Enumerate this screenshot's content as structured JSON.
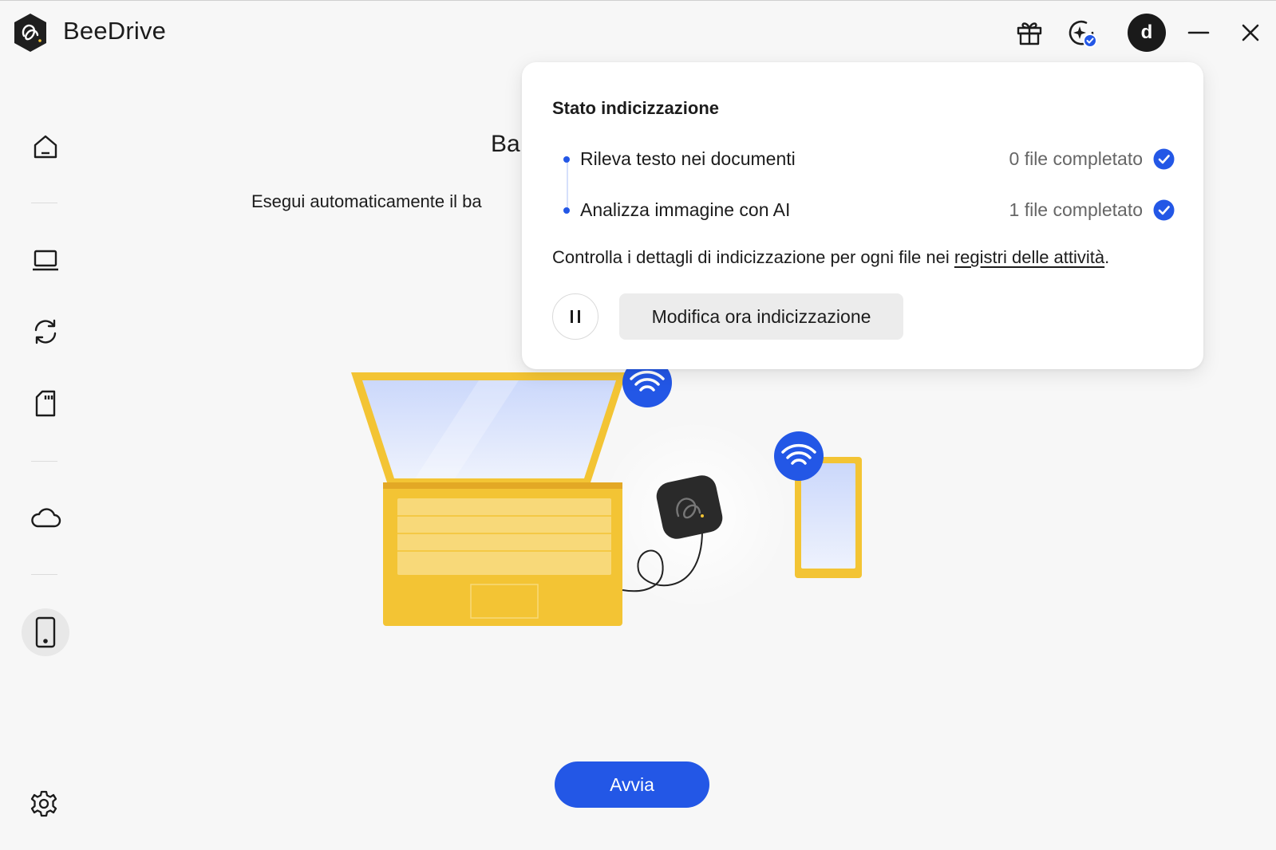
{
  "app": {
    "title": "BeeDrive"
  },
  "topbar": {
    "avatar_letter": "d"
  },
  "sidebar": {
    "items": [
      {
        "icon": "home-icon"
      },
      {
        "icon": "laptop-icon"
      },
      {
        "icon": "sync-icon"
      },
      {
        "icon": "sd-card-icon"
      },
      {
        "icon": "cloud-icon"
      },
      {
        "icon": "mobile-phone-icon"
      },
      {
        "icon": "gear-icon"
      }
    ]
  },
  "main": {
    "title_visible": "Ba",
    "description_visible": "Esegui automaticamente il ba",
    "start_button": "Avvia"
  },
  "popup": {
    "title": "Stato indicizzazione",
    "tasks": [
      {
        "name": "Rileva testo nei documenti",
        "status": "0 file completato"
      },
      {
        "name": "Analizza immagine con AI",
        "status": "1 file completato"
      }
    ],
    "note_prefix": "Controlla i dettagli di indicizzazione per ogni file nei ",
    "note_link": "registri delle attività",
    "note_suffix": ".",
    "modify_button": "Modifica ora indicizzazione"
  },
  "colors": {
    "accent": "#2357e6",
    "laptop": "#f3c434",
    "background": "#f7f7f7"
  }
}
